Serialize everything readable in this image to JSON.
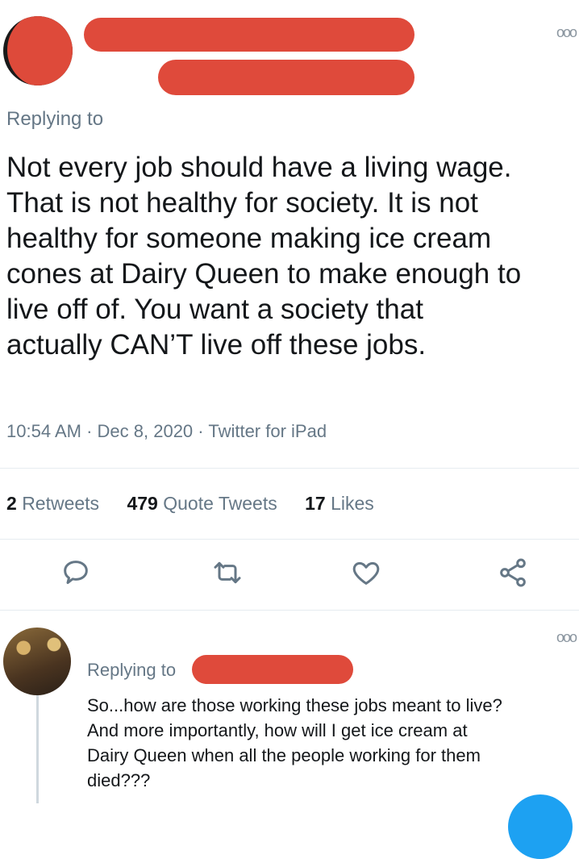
{
  "tweet": {
    "replying_label": "Replying to",
    "lines": [
      "Not every job should have a living wage.",
      "That is not healthy for society. It is not",
      "healthy for someone making ice cream",
      "cones at Dairy Queen to make enough to",
      "live off of.  You want a society that",
      "actually CAN’T live off these jobs."
    ],
    "time": "10:54 AM",
    "date": "Dec 8, 2020",
    "source": "Twitter for iPad",
    "retweets_count": "2",
    "retweets_label": "Retweets",
    "quotes_count": "479",
    "quotes_label": "Quote Tweets",
    "likes_count": "17",
    "likes_label": "Likes",
    "more_glyph": "ooo"
  },
  "reply": {
    "replying_label": "Replying to",
    "lines": [
      "So...how are those working these jobs meant to live?",
      "And more importantly, how will I get ice cream at",
      "Dairy Queen when all the people working for them",
      "died???"
    ],
    "more_glyph": "ooo"
  },
  "icons": [
    "reply-icon",
    "retweet-icon",
    "like-icon",
    "share-icon",
    "more-icon"
  ],
  "colors": {
    "redaction": "#df4a3b",
    "muted": "#657786",
    "accent": "#1da1f2"
  }
}
